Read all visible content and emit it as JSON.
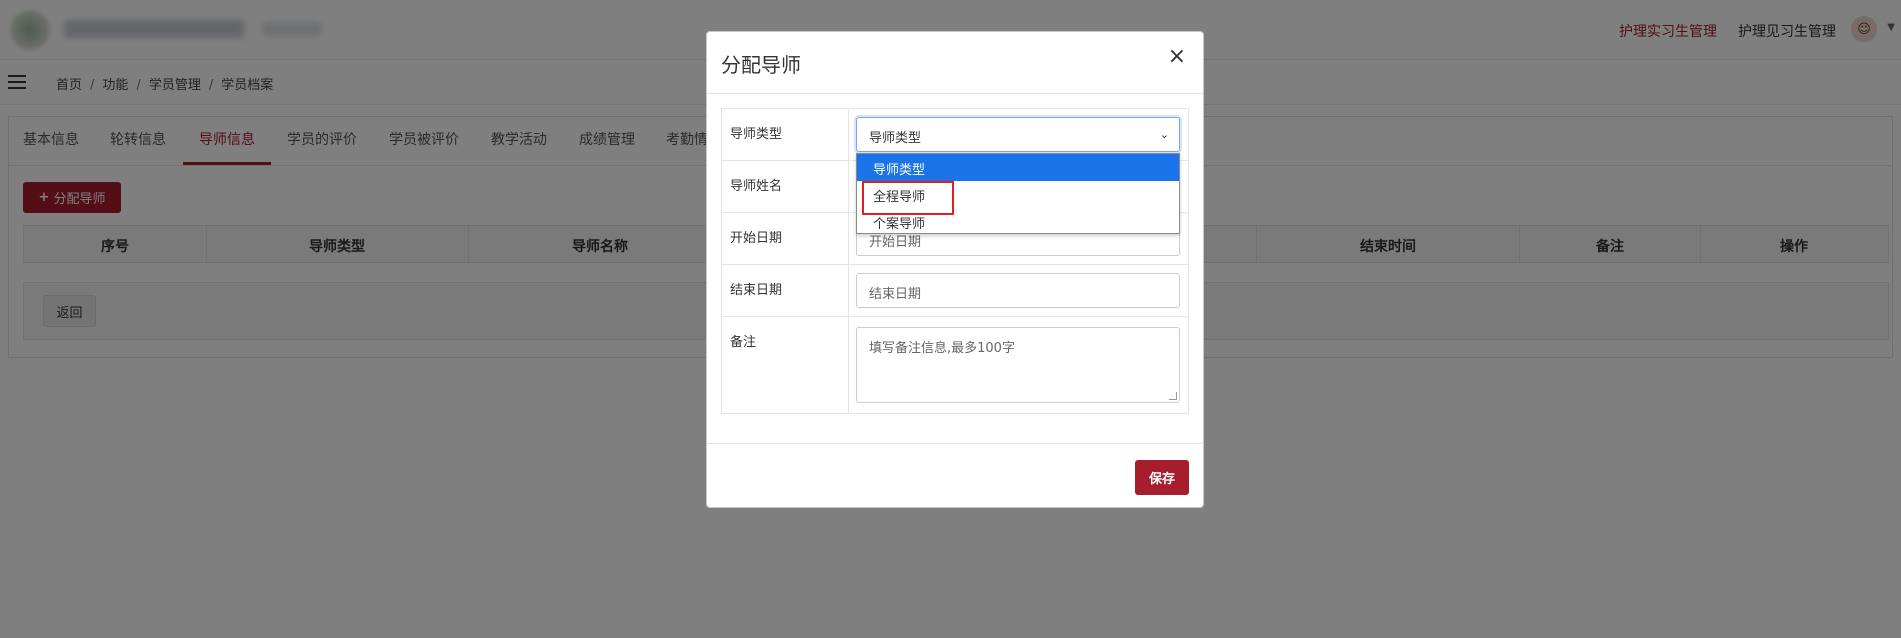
{
  "header": {
    "nav_intern": "护理实习生管理",
    "nav_trainee": "护理见习生管理",
    "avatar_glyph": "☺"
  },
  "breadcrumb": [
    "首页",
    "功能",
    "学员管理",
    "学员档案"
  ],
  "tabs": [
    "基本信息",
    "轮转信息",
    "导师信息",
    "学员的评价",
    "学员被评价",
    "教学活动",
    "成绩管理",
    "考勤情"
  ],
  "active_tab": "导师信息",
  "toolbar": {
    "assign_label": "分配导师",
    "assign_icon": "+"
  },
  "table": {
    "headers": [
      "序号",
      "导师类型",
      "导师名称",
      "结束时间",
      "备注",
      "操作"
    ]
  },
  "back_label": "返回",
  "modal": {
    "title": "分配导师",
    "close_glyph": "×",
    "fields": {
      "type_label": "导师类型",
      "name_label": "导师姓名",
      "start_label": "开始日期",
      "end_label": "结束日期",
      "notes_label": "备注"
    },
    "type_select_value": "导师类型",
    "type_options": [
      "导师类型",
      "全程导师",
      "个案导师"
    ],
    "start_placeholder": "开始日期",
    "end_placeholder": "结束日期",
    "notes_placeholder": "填写备注信息,最多100字",
    "save_label": "保存"
  },
  "colors": {
    "accent": "#a61d2d",
    "select_highlight": "#1a73e8",
    "annotation_box": "#e02020"
  }
}
